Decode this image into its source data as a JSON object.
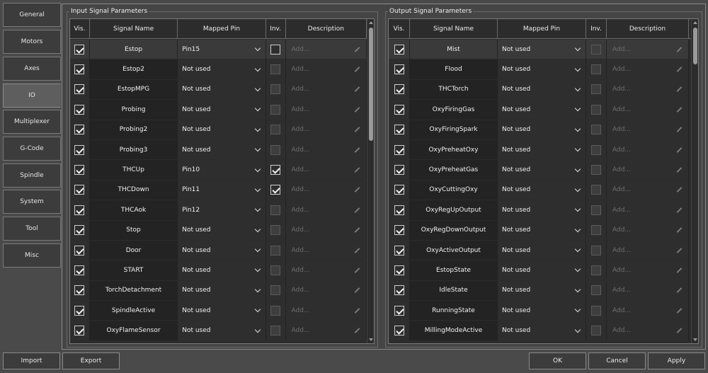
{
  "sidebar": {
    "items": [
      {
        "label": "General"
      },
      {
        "label": "Motors"
      },
      {
        "label": "Axes"
      },
      {
        "label": "IO",
        "active": true
      },
      {
        "label": "Multiplexer"
      },
      {
        "label": "G-Code"
      },
      {
        "label": "Spindle"
      },
      {
        "label": "System"
      },
      {
        "label": "Tool"
      },
      {
        "label": "Misc"
      }
    ]
  },
  "input": {
    "title": "Input Signal Parameters",
    "columns": [
      "Vis.",
      "Signal Name",
      "Mapped Pin",
      "Inv.",
      "Description"
    ],
    "rows": [
      {
        "vis": true,
        "name": "Estop",
        "pin": "Pin15",
        "inv": false,
        "inv_enabled": true,
        "desc": "Add..."
      },
      {
        "vis": true,
        "name": "Estop2",
        "pin": "Not used",
        "inv": false,
        "inv_enabled": false,
        "desc": "Add..."
      },
      {
        "vis": true,
        "name": "EstopMPG",
        "pin": "Not used",
        "inv": false,
        "inv_enabled": false,
        "desc": "Add..."
      },
      {
        "vis": true,
        "name": "Probing",
        "pin": "Not used",
        "inv": false,
        "inv_enabled": false,
        "desc": "Add..."
      },
      {
        "vis": true,
        "name": "Probing2",
        "pin": "Not used",
        "inv": false,
        "inv_enabled": false,
        "desc": "Add..."
      },
      {
        "vis": true,
        "name": "Probing3",
        "pin": "Not used",
        "inv": false,
        "inv_enabled": false,
        "desc": "Add..."
      },
      {
        "vis": true,
        "name": "THCUp",
        "pin": "Pin10",
        "inv": true,
        "inv_enabled": true,
        "desc": "Add..."
      },
      {
        "vis": true,
        "name": "THCDown",
        "pin": "Pin11",
        "inv": true,
        "inv_enabled": true,
        "desc": "Add..."
      },
      {
        "vis": true,
        "name": "THCAok",
        "pin": "Pin12",
        "inv": false,
        "inv_enabled": false,
        "desc": "Add..."
      },
      {
        "vis": true,
        "name": "Stop",
        "pin": "Not used",
        "inv": false,
        "inv_enabled": false,
        "desc": "Add..."
      },
      {
        "vis": true,
        "name": "Door",
        "pin": "Not used",
        "inv": false,
        "inv_enabled": false,
        "desc": "Add..."
      },
      {
        "vis": true,
        "name": "START",
        "pin": "Not used",
        "inv": false,
        "inv_enabled": false,
        "desc": "Add..."
      },
      {
        "vis": true,
        "name": "TorchDetachment",
        "pin": "Not used",
        "inv": false,
        "inv_enabled": false,
        "desc": "Add..."
      },
      {
        "vis": true,
        "name": "SpindleActive",
        "pin": "Not used",
        "inv": false,
        "inv_enabled": false,
        "desc": "Add..."
      },
      {
        "vis": true,
        "name": "OxyFlameSensor",
        "pin": "Not used",
        "inv": false,
        "inv_enabled": false,
        "desc": "Add..."
      }
    ]
  },
  "output": {
    "title": "Output Signal Parameters",
    "columns": [
      "Vis.",
      "Signal Name",
      "Mapped Pin",
      "Inv.",
      "Description"
    ],
    "rows": [
      {
        "vis": true,
        "name": "Mist",
        "pin": "Not used",
        "inv": false,
        "desc": "Add..."
      },
      {
        "vis": true,
        "name": "Flood",
        "pin": "Not used",
        "inv": false,
        "desc": "Add..."
      },
      {
        "vis": true,
        "name": "THCTorch",
        "pin": "Not used",
        "inv": false,
        "desc": "Add..."
      },
      {
        "vis": true,
        "name": "OxyFiringGas",
        "pin": "Not used",
        "inv": false,
        "desc": "Add..."
      },
      {
        "vis": true,
        "name": "OxyFiringSpark",
        "pin": "Not used",
        "inv": false,
        "desc": "Add..."
      },
      {
        "vis": true,
        "name": "OxyPreheatOxy",
        "pin": "Not used",
        "inv": false,
        "desc": "Add..."
      },
      {
        "vis": true,
        "name": "OxyPreheatGas",
        "pin": "Not used",
        "inv": false,
        "desc": "Add..."
      },
      {
        "vis": true,
        "name": "OxyCuttingOxy",
        "pin": "Not used",
        "inv": false,
        "desc": "Add..."
      },
      {
        "vis": true,
        "name": "OxyRegUpOutput",
        "pin": "Not used",
        "inv": false,
        "desc": "Add..."
      },
      {
        "vis": true,
        "name": "OxyRegDownOutput",
        "pin": "Not used",
        "inv": false,
        "desc": "Add..."
      },
      {
        "vis": true,
        "name": "OxyActiveOutput",
        "pin": "Not used",
        "inv": false,
        "desc": "Add..."
      },
      {
        "vis": true,
        "name": "EstopState",
        "pin": "Not used",
        "inv": false,
        "desc": "Add..."
      },
      {
        "vis": true,
        "name": "IdleState",
        "pin": "Not used",
        "inv": false,
        "desc": "Add..."
      },
      {
        "vis": true,
        "name": "RunningState",
        "pin": "Not used",
        "inv": false,
        "desc": "Add..."
      },
      {
        "vis": true,
        "name": "MillingModeActive",
        "pin": "Not used",
        "inv": false,
        "desc": "Add..."
      }
    ]
  },
  "footer": {
    "import_label": "Import",
    "export_label": "Export",
    "ok_label": "OK",
    "cancel_label": "Cancel",
    "apply_label": "Apply"
  }
}
